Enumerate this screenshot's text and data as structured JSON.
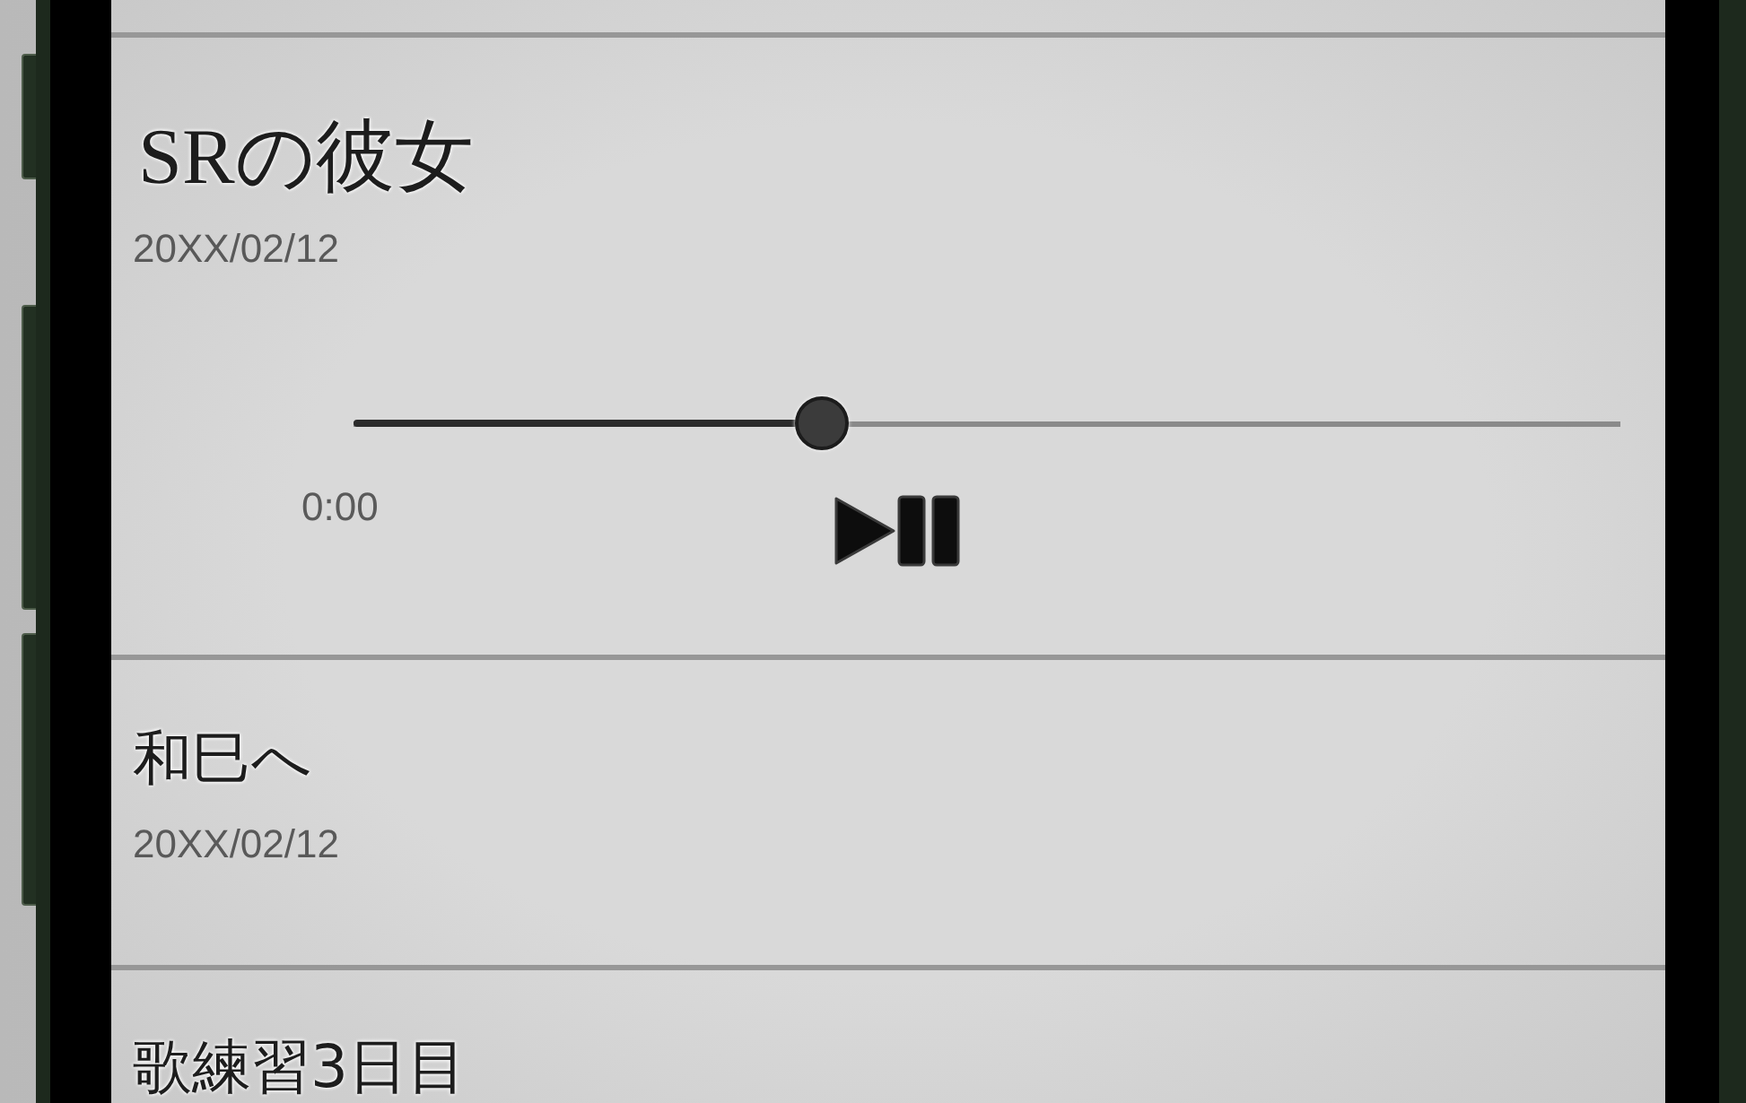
{
  "memos": [
    {
      "title": "SRの彼女",
      "date": "20XX/02/12",
      "expanded": true,
      "player": {
        "level": 0.37,
        "time": "0:00"
      }
    },
    {
      "title": "和巳へ",
      "date": "20XX/02/12",
      "expanded": false
    },
    {
      "title": "歌練習3日目",
      "expanded": false
    }
  ]
}
